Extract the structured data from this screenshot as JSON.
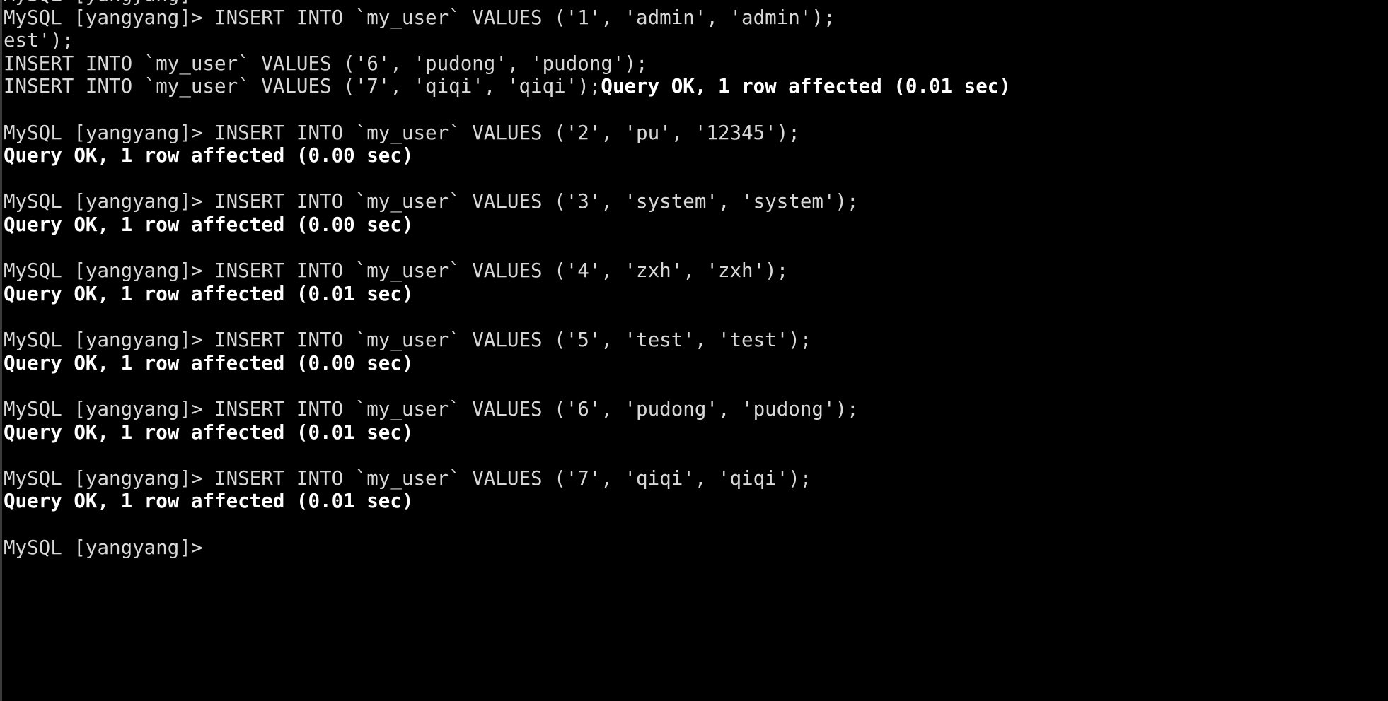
{
  "terminal": {
    "window_kind": "mysql-client-terminal",
    "background_color": "#000000",
    "foreground_color": "#d8d8d8",
    "bold_color": "#ffffff",
    "prompt": "MySQL [yangyang]>",
    "database": "yangyang",
    "table": "my_user",
    "columns": 98,
    "rows": 31,
    "cursor_line_index": 26,
    "lines": [
      {
        "id": "line-00",
        "kind": "prompt",
        "clipped": true,
        "text": "MySQL [yangyang]>"
      },
      {
        "id": "line-01",
        "kind": "prompt-command",
        "text": "MySQL [yangyang]> INSERT INTO `my_user` VALUES ('1', 'admin', 'admin');"
      },
      {
        "id": "line-02",
        "kind": "command-continuation",
        "text": "est');"
      },
      {
        "id": "line-03",
        "kind": "command-continuation",
        "text": "INSERT INTO `my_user` VALUES ('6', 'pudong', 'pudong');"
      },
      {
        "id": "line-04",
        "kind": "command-with-inline-result",
        "text": "INSERT INTO `my_user` VALUES ('7', 'qiqi', 'qiqi');",
        "bold_suffix": "Query OK, 1 row affected (0.01 sec)"
      },
      {
        "id": "line-05",
        "kind": "blank",
        "text": ""
      },
      {
        "id": "line-06",
        "kind": "prompt-command",
        "text": "MySQL [yangyang]> INSERT INTO `my_user` VALUES ('2', 'pu', '12345');"
      },
      {
        "id": "line-07",
        "kind": "result",
        "bold": true,
        "text": "Query OK, 1 row affected (0.00 sec)"
      },
      {
        "id": "line-08",
        "kind": "blank",
        "text": ""
      },
      {
        "id": "line-09",
        "kind": "prompt-command",
        "text": "MySQL [yangyang]> INSERT INTO `my_user` VALUES ('3', 'system', 'system');"
      },
      {
        "id": "line-10",
        "kind": "result",
        "bold": true,
        "text": "Query OK, 1 row affected (0.00 sec)"
      },
      {
        "id": "line-11",
        "kind": "blank",
        "text": ""
      },
      {
        "id": "line-12",
        "kind": "prompt-command",
        "text": "MySQL [yangyang]> INSERT INTO `my_user` VALUES ('4', 'zxh', 'zxh');"
      },
      {
        "id": "line-13",
        "kind": "result",
        "bold": true,
        "text": "Query OK, 1 row affected (0.01 sec)"
      },
      {
        "id": "line-14",
        "kind": "blank",
        "text": ""
      },
      {
        "id": "line-15",
        "kind": "prompt-command",
        "text": "MySQL [yangyang]> INSERT INTO `my_user` VALUES ('5', 'test', 'test');"
      },
      {
        "id": "line-16",
        "kind": "result",
        "bold": true,
        "text": "Query OK, 1 row affected (0.00 sec)"
      },
      {
        "id": "line-17",
        "kind": "blank",
        "text": ""
      },
      {
        "id": "line-18",
        "kind": "prompt-command",
        "text": "MySQL [yangyang]> INSERT INTO `my_user` VALUES ('6', 'pudong', 'pudong');"
      },
      {
        "id": "line-19",
        "kind": "result",
        "bold": true,
        "text": "Query OK, 1 row affected (0.01 sec)"
      },
      {
        "id": "line-20",
        "kind": "blank",
        "text": ""
      },
      {
        "id": "line-21",
        "kind": "prompt-command",
        "text": "MySQL [yangyang]> INSERT INTO `my_user` VALUES ('7', 'qiqi', 'qiqi');"
      },
      {
        "id": "line-22",
        "kind": "result",
        "bold": true,
        "text": "Query OK, 1 row affected (0.01 sec)"
      },
      {
        "id": "line-23",
        "kind": "blank",
        "text": ""
      },
      {
        "id": "line-24",
        "kind": "prompt",
        "clipped": true,
        "text": "MySQL [yangyang]>"
      }
    ]
  }
}
